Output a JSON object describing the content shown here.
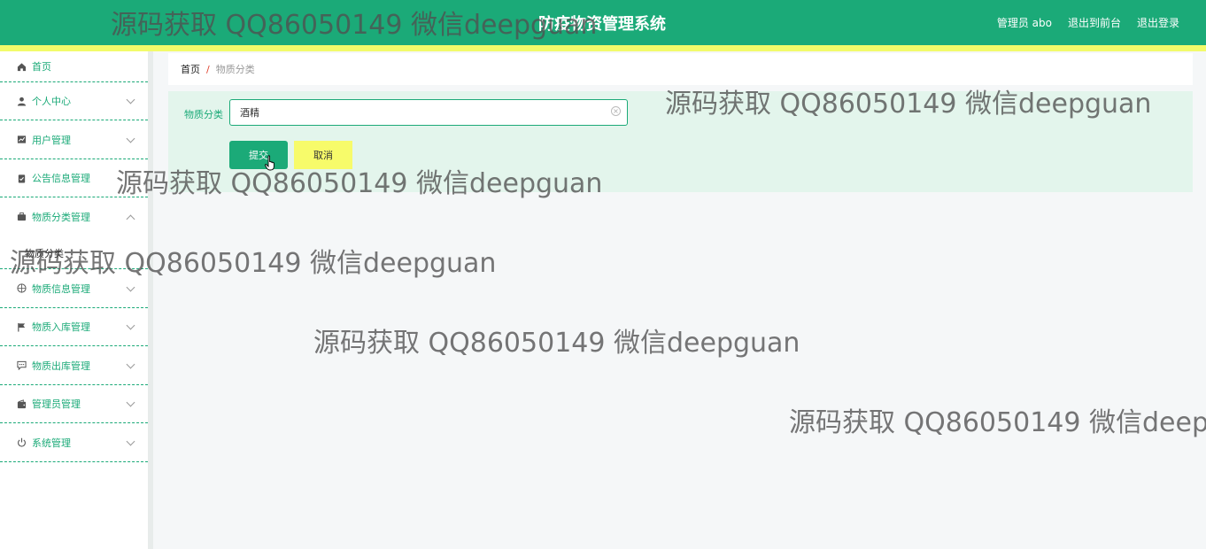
{
  "header": {
    "title": "防疫物资管理系统",
    "user_label": "管理员 abo",
    "frontend_link": "退出到前台",
    "logout_link": "退出登录"
  },
  "sidebar": {
    "items": [
      {
        "label": "首页",
        "icon": "home-icon"
      },
      {
        "label": "个人中心",
        "icon": "user-icon"
      },
      {
        "label": "用户管理",
        "icon": "chart-icon"
      },
      {
        "label": "公告信息管理",
        "icon": "clipboard-icon"
      },
      {
        "label": "物质分类管理",
        "icon": "briefcase-icon"
      },
      {
        "label": "物质信息管理",
        "icon": "compass-icon"
      },
      {
        "label": "物质入库管理",
        "icon": "flag-icon"
      },
      {
        "label": "物质出库管理",
        "icon": "chat-icon"
      },
      {
        "label": "管理员管理",
        "icon": "wallet-icon"
      },
      {
        "label": "系统管理",
        "icon": "power-icon"
      }
    ],
    "submenu_label": "物质分类"
  },
  "breadcrumb": {
    "home": "首页",
    "separator": "/",
    "current": "物质分类"
  },
  "form": {
    "field_label": "物质分类",
    "field_value": "酒精",
    "submit_label": "提交",
    "cancel_label": "取消"
  },
  "watermark": "源码获取 QQ86050149 微信deepguan",
  "colors": {
    "primary": "#1baa78",
    "accent_yellow": "#f2fb6a",
    "panel_bg": "#e3f5ec"
  }
}
